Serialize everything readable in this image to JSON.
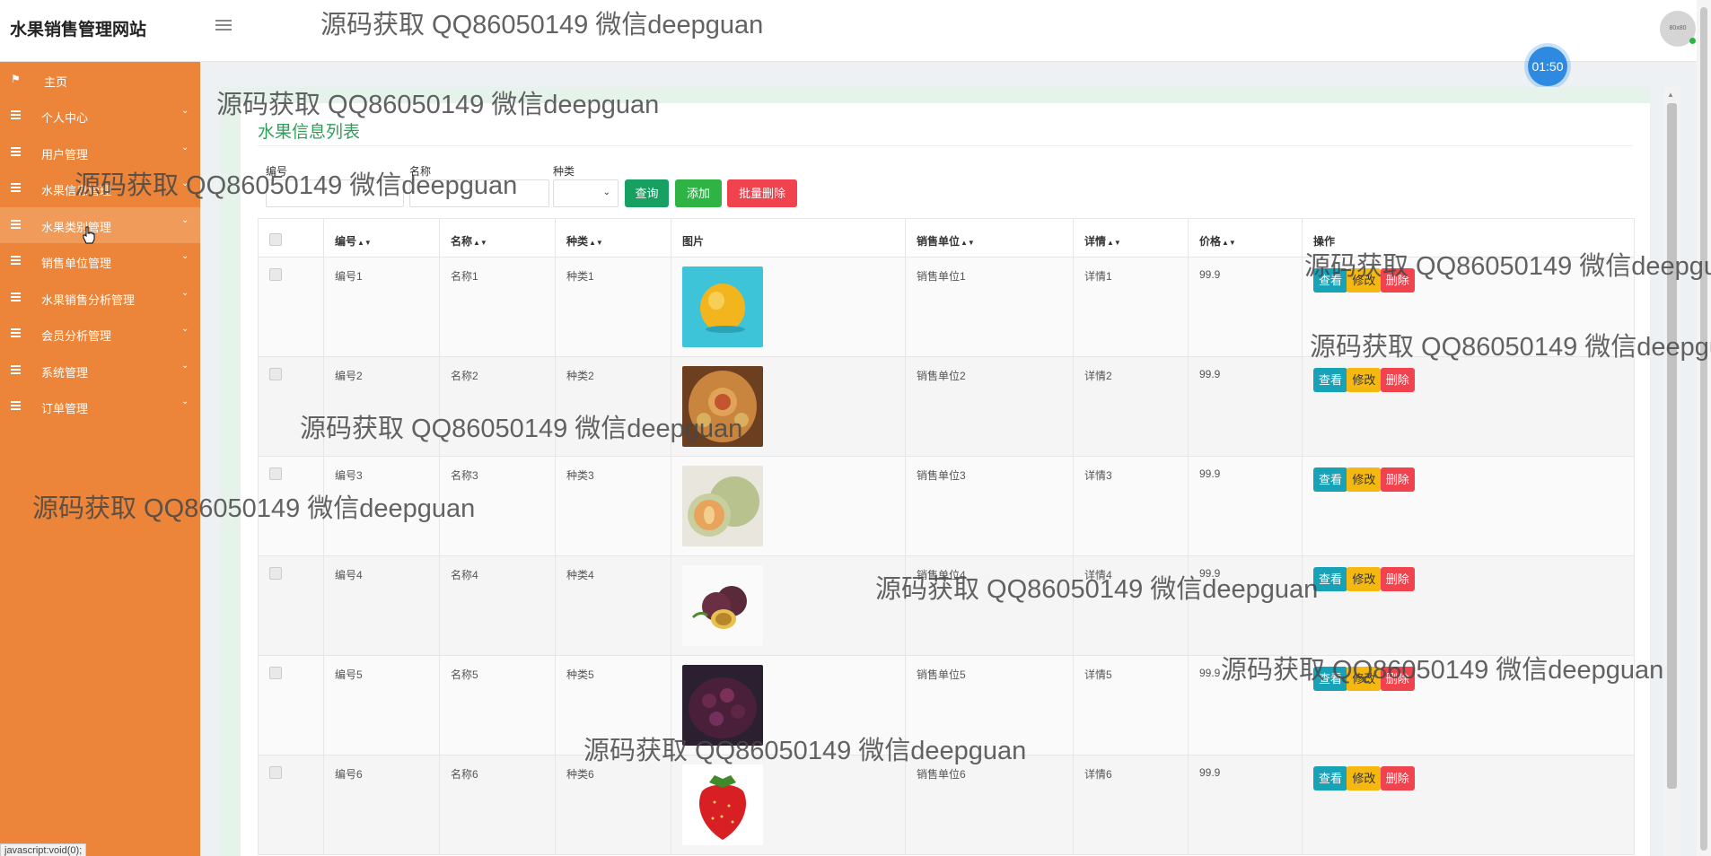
{
  "app": {
    "title": "水果销售管理网站",
    "avatar_text": "80x80",
    "timer": "01:50"
  },
  "sidebar": {
    "items": [
      {
        "label": "主页",
        "icon": "flag-icon"
      },
      {
        "label": "个人中心",
        "icon": "list-icon"
      },
      {
        "label": "用户管理",
        "icon": "list-icon"
      },
      {
        "label": "水果信息管理",
        "icon": "list-icon"
      },
      {
        "label": "水果类别管理",
        "icon": "list-icon"
      },
      {
        "label": "销售单位管理",
        "icon": "list-icon"
      },
      {
        "label": "水果销售分析管理",
        "icon": "list-icon"
      },
      {
        "label": "会员分析管理",
        "icon": "list-icon"
      },
      {
        "label": "系统管理",
        "icon": "list-icon"
      },
      {
        "label": "订单管理",
        "icon": "list-icon"
      }
    ],
    "status_url": "javascript:void(0);"
  },
  "page": {
    "title": "水果信息列表"
  },
  "search": {
    "code_label": "编号",
    "name_label": "名称",
    "type_label": "种类",
    "query_button": "查询",
    "add_button": "添加",
    "batch_delete_button": "批量删除"
  },
  "table": {
    "headers": [
      "编号",
      "名称",
      "种类",
      "图片",
      "销售单位",
      "详情",
      "价格",
      "操作"
    ],
    "actions": {
      "view": "查看",
      "edit": "修改",
      "delete": "删除"
    },
    "rows": [
      {
        "code": "编号1",
        "name": "名称1",
        "type": "种类1",
        "image": "lemon",
        "unit": "销售单位1",
        "detail": "详情1",
        "price": "99.9"
      },
      {
        "code": "编号2",
        "name": "名称2",
        "type": "种类2",
        "image": "carved-melon",
        "unit": "销售单位2",
        "detail": "详情2",
        "price": "99.9"
      },
      {
        "code": "编号3",
        "name": "名称3",
        "type": "种类3",
        "image": "cantaloupe",
        "unit": "销售单位3",
        "detail": "详情3",
        "price": "99.9"
      },
      {
        "code": "编号4",
        "name": "名称4",
        "type": "种类4",
        "image": "passion-fruit",
        "unit": "销售单位4",
        "detail": "详情4",
        "price": "99.9"
      },
      {
        "code": "编号5",
        "name": "名称5",
        "type": "种类5",
        "image": "mulberries",
        "unit": "销售单位5",
        "detail": "详情5",
        "price": "99.9"
      },
      {
        "code": "编号6",
        "name": "名称6",
        "type": "种类6",
        "image": "strawberry",
        "unit": "销售单位6",
        "detail": "详情6",
        "price": "99.9"
      }
    ]
  },
  "watermark": {
    "text": "源码获取 QQ86050149 微信deepguan"
  }
}
